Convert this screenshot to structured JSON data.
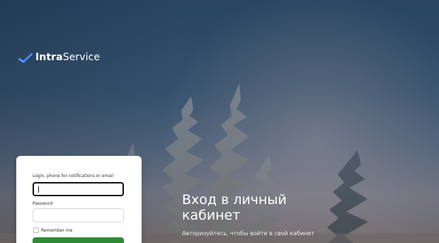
{
  "brand": {
    "strong": "Intra",
    "regular": "Service"
  },
  "hero": {
    "title": "Вход в личный кабинет",
    "subtitle": "Авторизуйтесь, чтобы войти в свой кабинет"
  },
  "login_form": {
    "login_label": "Login, phone for notifications or email",
    "login_value": "",
    "password_label": "Password",
    "password_value": "",
    "remember_me_label": "Remember me"
  },
  "colors": {
    "accent": "#2f8b33",
    "brand_check": "#4a83ff",
    "background_top": "#274461",
    "background_bottom": "#706a6a",
    "card": "#ffffff"
  },
  "icons": {
    "brand_mark": "checkmark-icon",
    "remember_checkbox": "checkbox-icon"
  }
}
